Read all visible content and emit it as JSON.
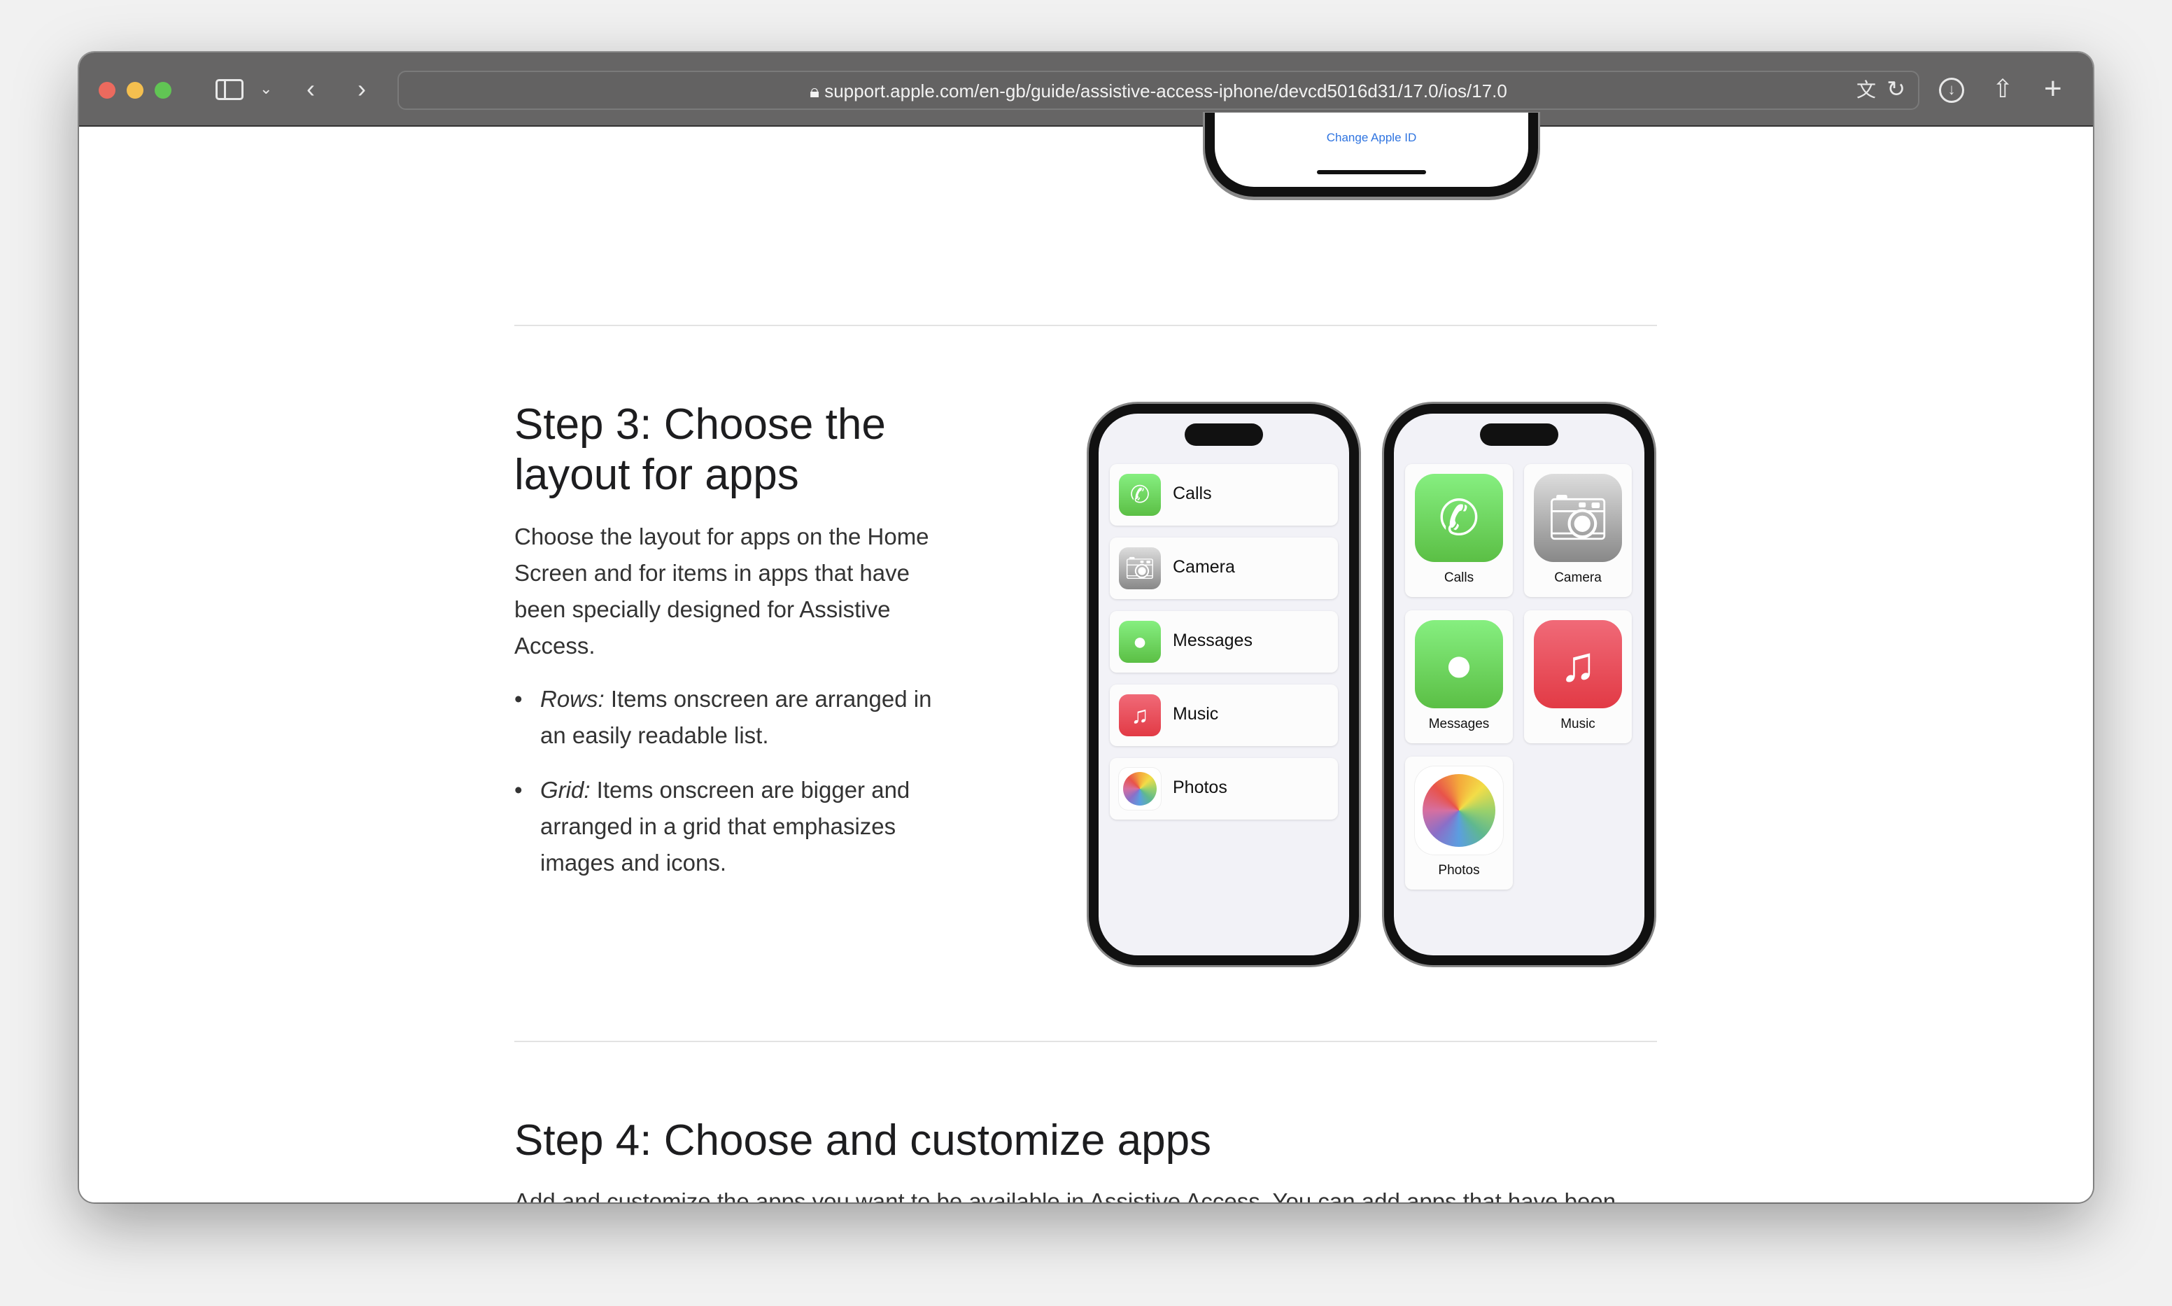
{
  "browser": {
    "url": "support.apple.com/en-gb/guide/assistive-access-iphone/devcd5016d31/17.0/ios/17.0",
    "traffic_lights": [
      "#ec6a5e",
      "#f4bf4f",
      "#61c554"
    ]
  },
  "top_phone": {
    "link": "Change Apple ID",
    "link_color": "#2f74e0"
  },
  "step3": {
    "title": "Step 3: Choose the layout for apps",
    "body": "Choose the layout for apps on the Home Screen and for items in apps that have been specially designed for Assistive Access.",
    "bullets": [
      {
        "term": "Rows:",
        "text": " Items onscreen are arranged in an easily readable list."
      },
      {
        "term": "Grid:",
        "text": " Items onscreen are bigger and arranged in a grid that emphasizes images and icons."
      }
    ],
    "rows_apps": [
      "Calls",
      "Camera",
      "Messages",
      "Music",
      "Photos"
    ],
    "grid_apps": [
      "Calls",
      "Camera",
      "Messages",
      "Music",
      "Photos"
    ]
  },
  "step4": {
    "title": "Step 4: Choose and customize apps",
    "body": "Add and customize the apps you want to be available in Assistive Access. You can add apps that have been optimized for Assistive Access, and most other iOS apps in their original design."
  }
}
